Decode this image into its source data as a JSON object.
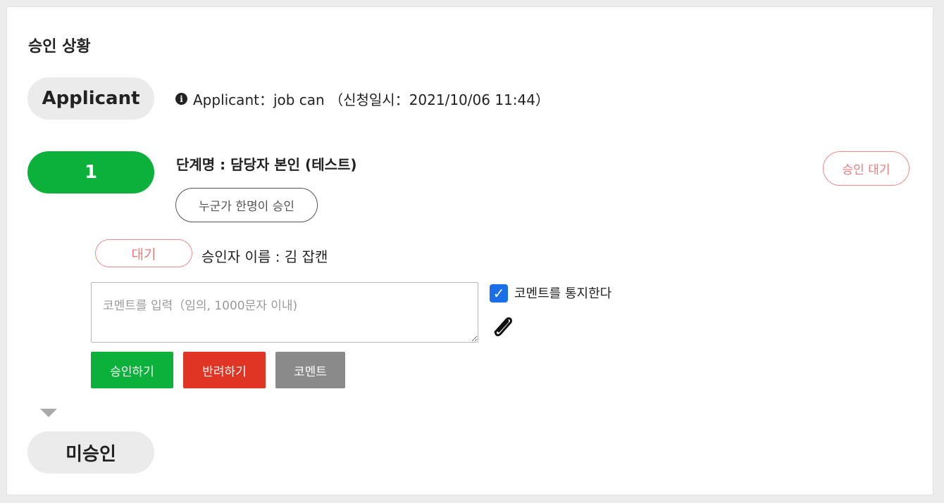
{
  "section_title": "승인 상황",
  "applicant": {
    "pill_label": "Applicant",
    "info_text": "Applicant：job can （신청일시：2021/10/06 11:44）"
  },
  "step": {
    "number_label": "1",
    "name": "단계명 : 담당자 본인 (테스트)",
    "rule_button": "누군가 한명이 승인",
    "status_badge": "승인 대기"
  },
  "approver": {
    "status": "대기",
    "name_line": "승인자 이름 : 김 잡캔"
  },
  "comment": {
    "placeholder": "코멘트를 입력（임의, 1000문자 이내)",
    "notify_label": "코멘트를 통지한다",
    "notify_checked": true
  },
  "buttons": {
    "approve": "승인하기",
    "reject": "반려하기",
    "comment": "코멘트"
  },
  "final_status": "미승인",
  "colors": {
    "green": "#0cb13b",
    "red": "#e03424",
    "grey_button": "#8a8a8a",
    "pending_pink": "#f07a7a",
    "checkbox_blue": "#1a6fe8"
  },
  "icons": [
    "info-icon",
    "check-icon",
    "paperclip-icon",
    "arrow-down-icon"
  ]
}
